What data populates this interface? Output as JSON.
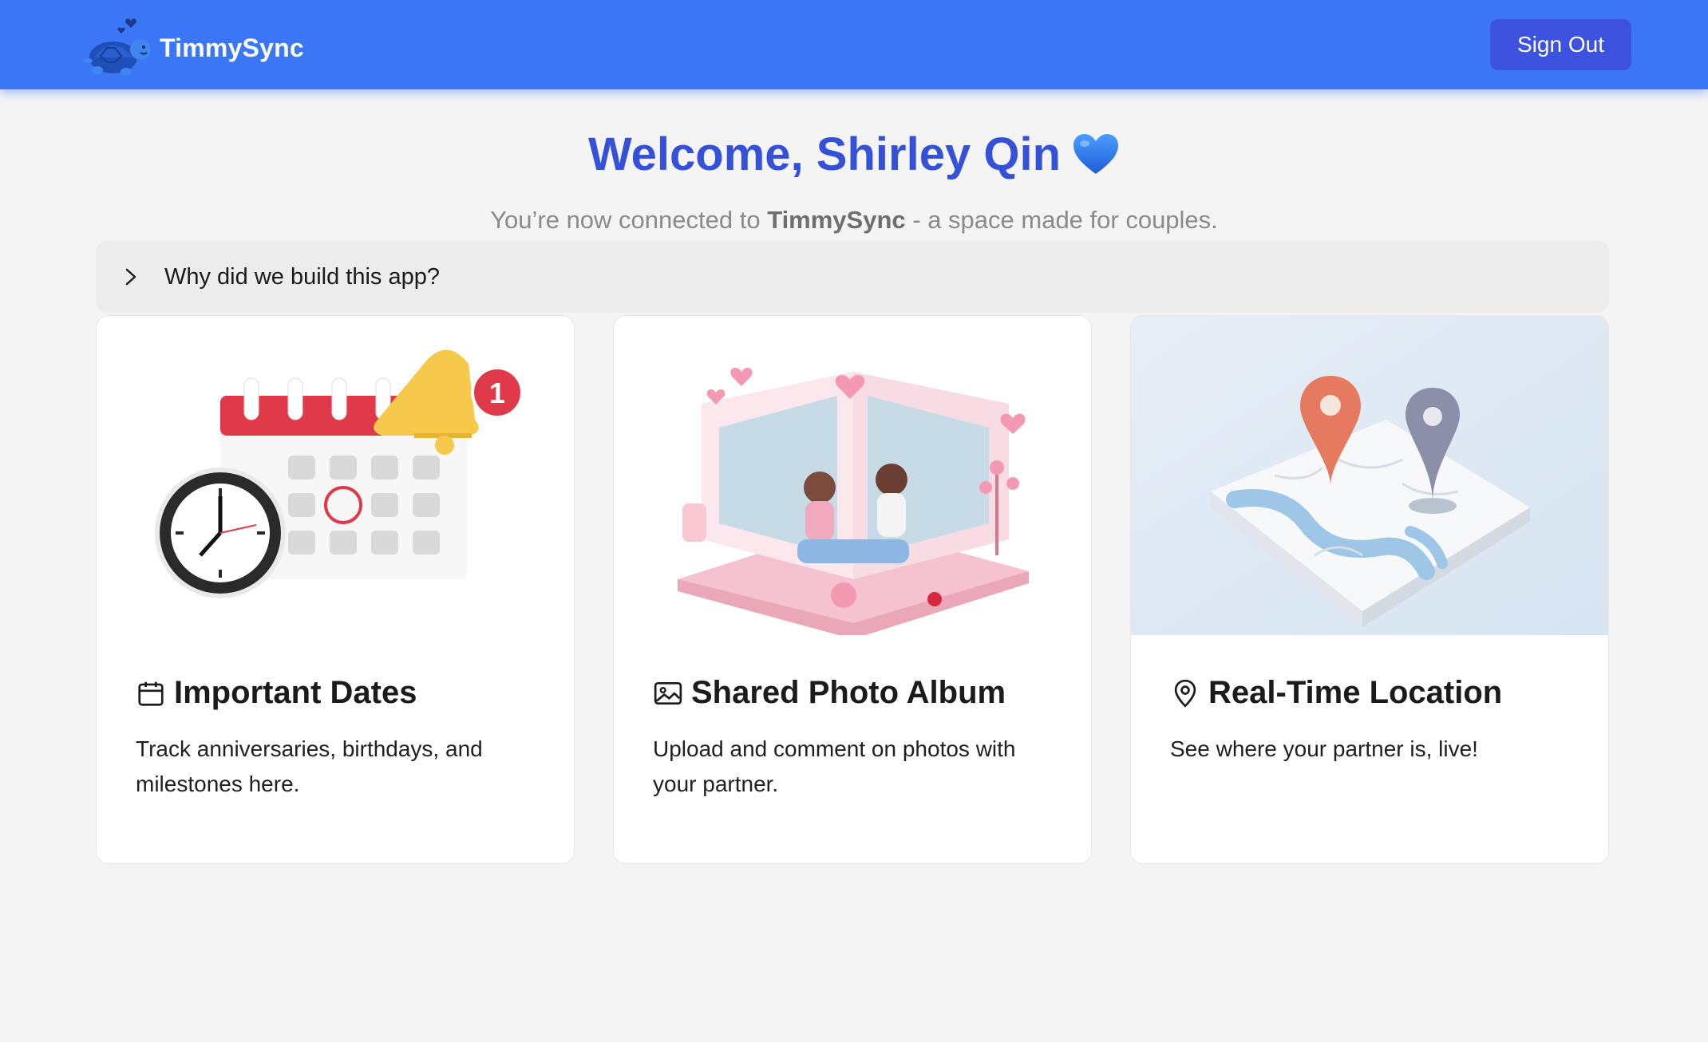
{
  "app": {
    "name": "TimmySync"
  },
  "header": {
    "sign_out_label": "Sign Out"
  },
  "welcome": {
    "greeting": "Welcome, Shirley Qin",
    "subtitle_prefix": "You’re now connected to ",
    "subtitle_brand": "TimmySync",
    "subtitle_suffix": " - a space made for couples."
  },
  "accordion": {
    "label": "Why did we build this app?"
  },
  "cards": [
    {
      "title": "Important Dates",
      "description": "Track anniversaries, birthdays, and milestones here.",
      "icon": "calendar-icon"
    },
    {
      "title": "Shared Photo Album",
      "description": "Upload and comment on photos with your partner.",
      "icon": "image-icon"
    },
    {
      "title": "Real-Time Location",
      "description": "See where your partner is, live!",
      "icon": "map-pin-icon"
    }
  ],
  "illustration_badge": "1",
  "colors": {
    "nav": "#3b76f6",
    "button": "#3d52de",
    "heading": "#3551d8"
  }
}
